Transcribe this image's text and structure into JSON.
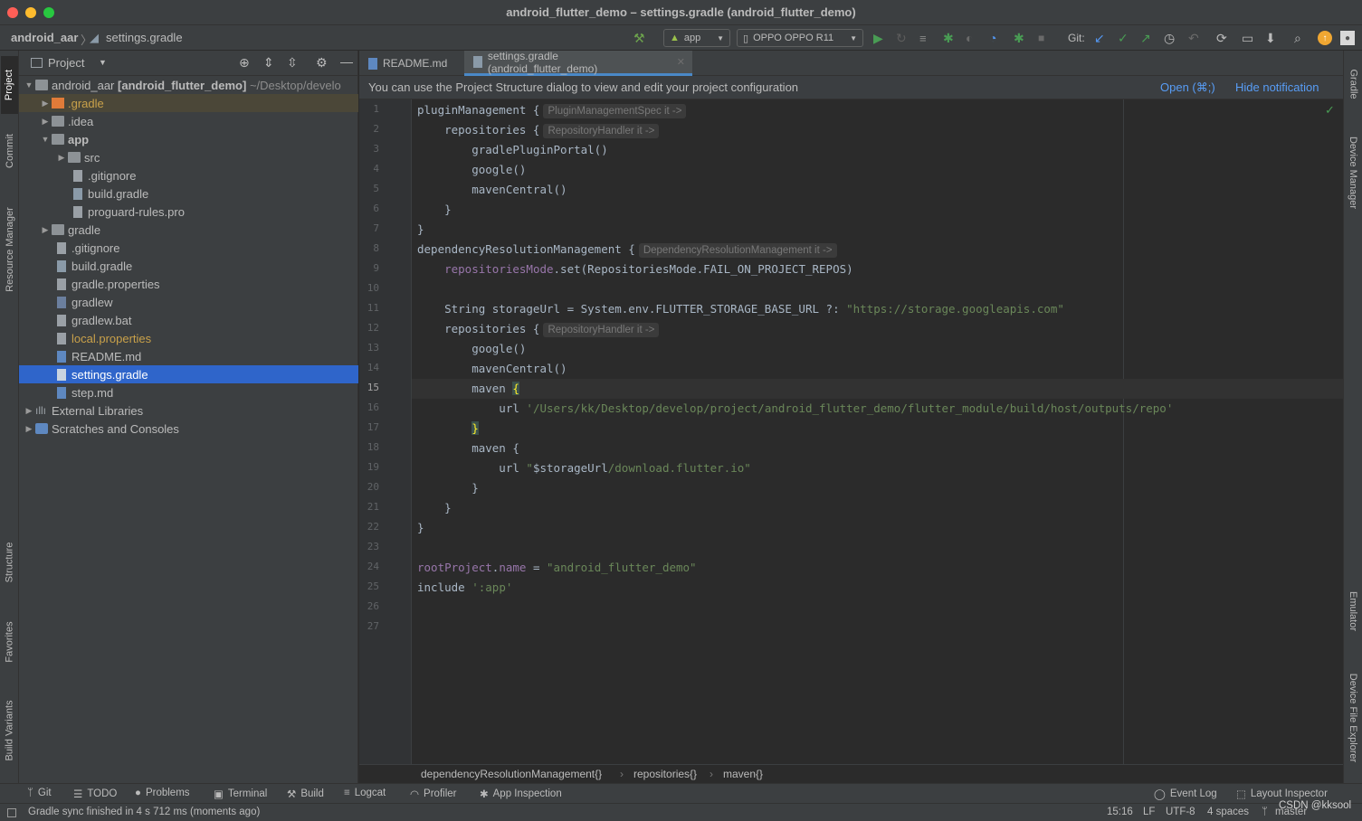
{
  "window": {
    "title": "android_flutter_demo – settings.gradle (android_flutter_demo)"
  },
  "nav": {
    "project": "android_aar",
    "file": "settings.gradle"
  },
  "toolbar": {
    "config": "app",
    "device": "OPPO OPPO R11",
    "git_label": "Git:"
  },
  "left_strip": {
    "project": "Project",
    "commit": "Commit",
    "resource_manager": "Resource Manager",
    "structure": "Structure",
    "favorites": "Favorites",
    "build_variants": "Build Variants"
  },
  "right_strip": {
    "gradle": "Gradle",
    "device_manager": "Device Manager",
    "emulator": "Emulator",
    "device_file_explorer": "Device File Explorer"
  },
  "project_panel": {
    "title": "Project",
    "tree": [
      {
        "label": "android_aar",
        "suffix": "[android_flutter_demo]",
        "path": "~/Desktop/develo"
      },
      {
        "label": ".gradle"
      },
      {
        "label": ".idea"
      },
      {
        "label": "app"
      },
      {
        "label": "src"
      },
      {
        "label": ".gitignore"
      },
      {
        "label": "build.gradle"
      },
      {
        "label": "proguard-rules.pro"
      },
      {
        "label": "gradle"
      },
      {
        "label": ".gitignore"
      },
      {
        "label": "build.gradle"
      },
      {
        "label": "gradle.properties"
      },
      {
        "label": "gradlew"
      },
      {
        "label": "gradlew.bat"
      },
      {
        "label": "local.properties"
      },
      {
        "label": "README.md"
      },
      {
        "label": "settings.gradle"
      },
      {
        "label": "step.md"
      },
      {
        "label": "External Libraries"
      },
      {
        "label": "Scratches and Consoles"
      }
    ]
  },
  "editor": {
    "tabs": [
      {
        "label": "README.md"
      },
      {
        "label": "settings.gradle (android_flutter_demo)"
      }
    ],
    "notification": {
      "text": "You can use the Project Structure dialog to view and edit your project configuration",
      "open": "Open (⌘;)",
      "hide": "Hide notification"
    },
    "line_numbers": [
      "1",
      "2",
      "3",
      "4",
      "5",
      "6",
      "7",
      "8",
      "9",
      "10",
      "11",
      "12",
      "13",
      "14",
      "15",
      "16",
      "17",
      "18",
      "19",
      "20",
      "21",
      "22",
      "23",
      "24",
      "25",
      "26",
      "27"
    ],
    "code": {
      "l1": "pluginManagement {",
      "l1h": "PluginManagementSpec it ->",
      "l2": "    repositories {",
      "l2h": "RepositoryHandler it ->",
      "l3": "        gradlePluginPortal()",
      "l4": "        google()",
      "l5": "        mavenCentral()",
      "l6": "    }",
      "l7": "}",
      "l8": "dependencyResolutionManagement {",
      "l8h": "DependencyResolutionManagement it ->",
      "l9a": "    ",
      "l9b": "repositoriesMode",
      "l9c": ".set(RepositoriesMode.FAIL_ON_PROJECT_REPOS)",
      "l11a": "    String storageUrl = System.env.FLUTTER_STORAGE_BASE_URL ?: ",
      "l11b": "\"https://storage.googleapis.com\"",
      "l12": "    repositories {",
      "l12h": "RepositoryHandler it ->",
      "l13": "        google()",
      "l14": "        mavenCentral()",
      "l15a": "        maven ",
      "l15b": "{",
      "l16a": "            url ",
      "l16b": "'/Users/kk/Desktop/develop/project/android_flutter_demo/flutter_module/build/host/outputs/repo'",
      "l17a": "        ",
      "l17b": "}",
      "l18": "        maven {",
      "l19a": "            url ",
      "l19b": "\"",
      "l19c": "$storageUrl",
      "l19d": "/download.flutter.io\"",
      "l20": "        }",
      "l21": "    }",
      "l22": "}",
      "l24a": "rootProject",
      "l24b": ".",
      "l24c": "name",
      "l24d": " = ",
      "l24e": "\"android_flutter_demo\"",
      "l25a": "include ",
      "l25b": "':app'"
    },
    "breadcrumbs": [
      "dependencyResolutionManagement{}",
      "repositories{}",
      "maven{}"
    ]
  },
  "bottom_tools": {
    "git": "Git",
    "todo": "TODO",
    "problems": "Problems",
    "terminal": "Terminal",
    "build": "Build",
    "logcat": "Logcat",
    "profiler": "Profiler",
    "app_inspection": "App Inspection",
    "event_log": "Event Log",
    "layout_inspector": "Layout Inspector"
  },
  "status": {
    "message": "Gradle sync finished in 4 s 712 ms (moments ago)",
    "position": "15:16",
    "line_sep": "LF",
    "encoding": "UTF-8",
    "indent": "4 spaces",
    "branch": "master",
    "watermark": "CSDN @kksool"
  },
  "colors": {
    "accent": "#2f65ca",
    "string": "#6a8759",
    "property": "#9876aa",
    "link": "#589df6"
  }
}
